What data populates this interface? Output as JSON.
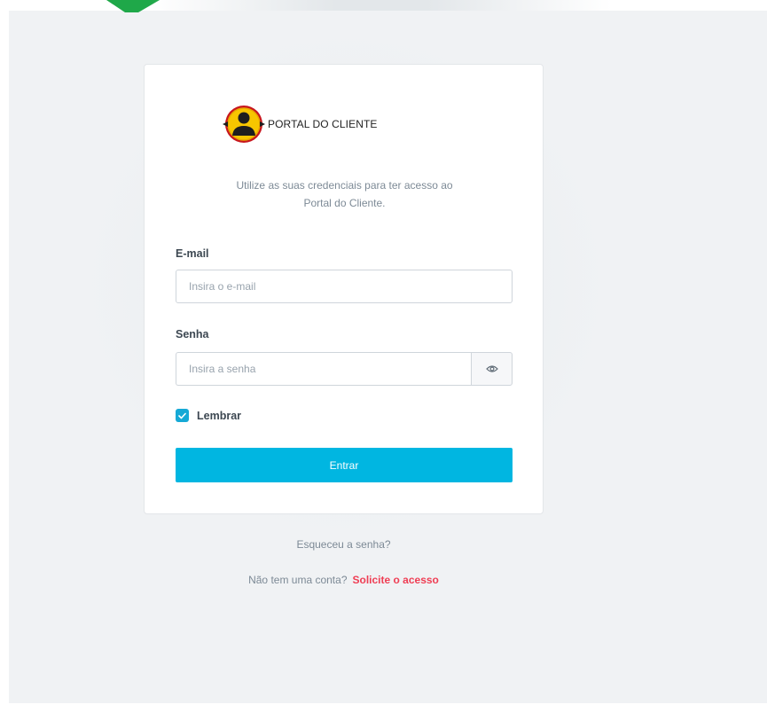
{
  "brand": {
    "title": "PORTAL DO CLIENTE",
    "logo_icon": "customer-portal-logo-icon"
  },
  "intro": {
    "line1": "Utilize as suas credenciais para ter acesso ao",
    "line2": "Portal do Cliente."
  },
  "email": {
    "label": "E-mail",
    "placeholder": "Insira o e-mail",
    "value": ""
  },
  "password": {
    "label": "Senha",
    "placeholder": "Insira a senha",
    "value": "",
    "toggle_icon": "eye-icon"
  },
  "remember": {
    "label": "Lembrar",
    "checked": true
  },
  "submit": {
    "label": "Entrar"
  },
  "links": {
    "forgot": "Esqueceu a senha?",
    "no_account": "Não tem uma conta?",
    "request_access": "Solicite o acesso"
  },
  "colors": {
    "primary": "#00b6e1",
    "checkbox": "#16a9d6",
    "link_accent": "#ef3e54",
    "deco_green": "#1fa849",
    "background": "#f0f2f4"
  }
}
